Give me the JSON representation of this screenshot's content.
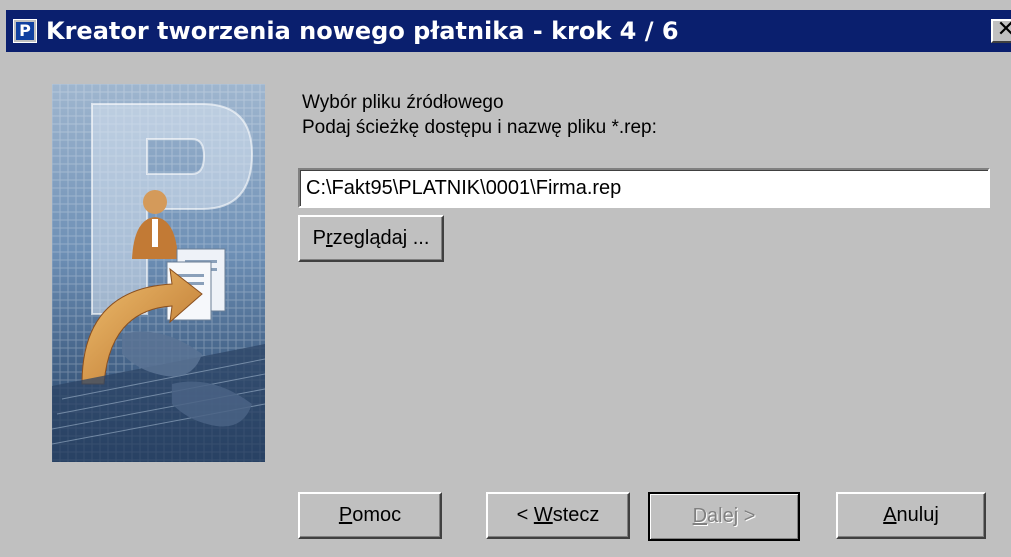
{
  "window": {
    "title": "Kreator tworzenia nowego płatnika - krok 4 / 6",
    "icon": "platnik-app-icon",
    "close_label": "✕"
  },
  "content": {
    "heading_line1": "Wybór pliku źródłowego",
    "heading_line2": "Podaj ścieżkę dostępu i nazwę pliku *.rep:",
    "path_value": "C:\\Fakt95\\PLATNIK\\0001\\Firma.rep",
    "browse_before": "P",
    "browse_mnemonic": "r",
    "browse_after": "zeglądaj ..."
  },
  "buttons": {
    "help_mnemonic": "P",
    "help_rest": "omoc",
    "back_prefix": "< ",
    "back_mnemonic": "W",
    "back_rest": "stecz",
    "next_mnemonic": "D",
    "next_rest": "alej >",
    "cancel_mnemonic": "A",
    "cancel_rest": "nuluj"
  },
  "colors": {
    "titlebar": "#0a1f6e",
    "face": "#c0c0c0"
  }
}
